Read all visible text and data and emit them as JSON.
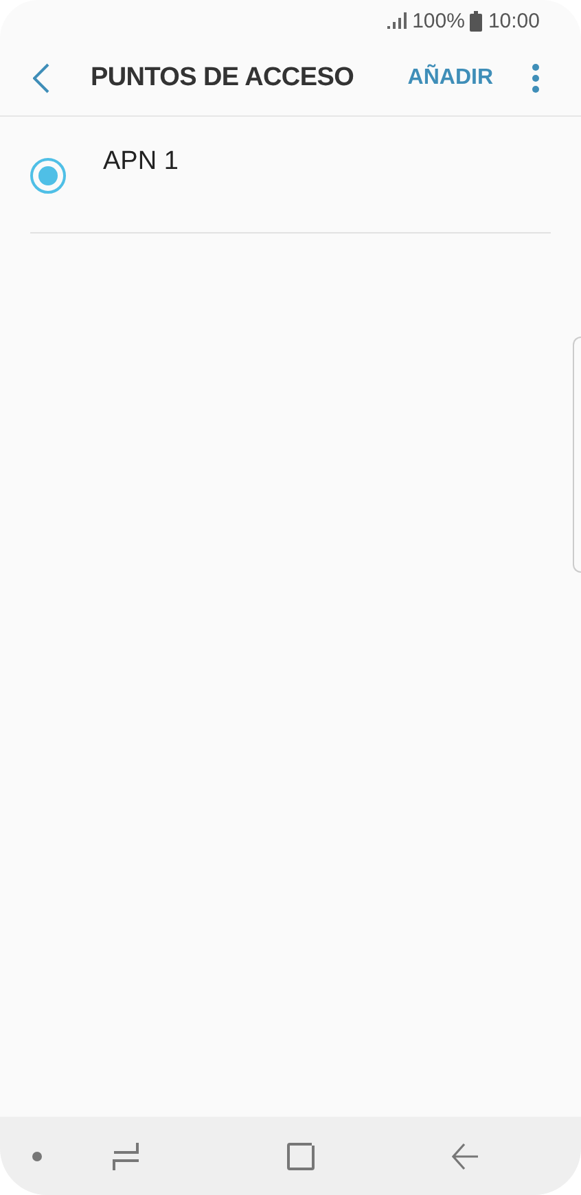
{
  "status_bar": {
    "battery": "100%",
    "time": "10:00"
  },
  "header": {
    "title": "PUNTOS DE ACCESO",
    "action": "AÑADIR"
  },
  "apns": [
    {
      "name": "APN 1",
      "selected": true
    }
  ]
}
